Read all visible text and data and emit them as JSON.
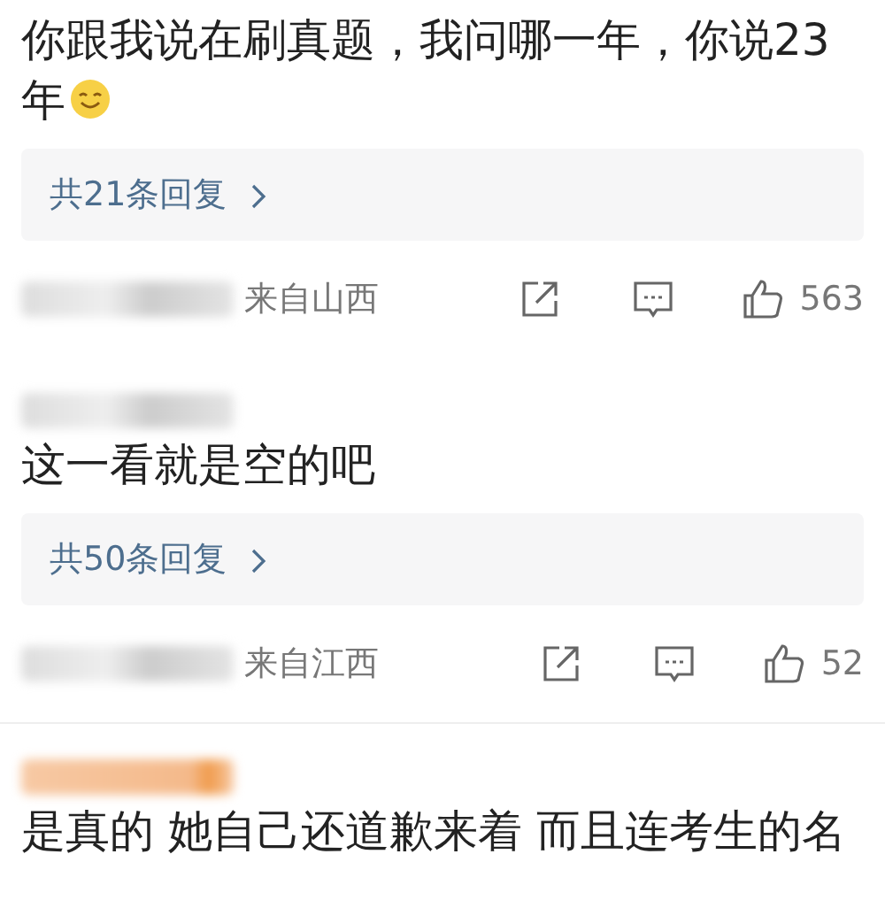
{
  "comments": [
    {
      "text": "你跟我说在刷真题，我问哪一年，你说23年",
      "emoji": true,
      "replies": "共21条回复",
      "location": "来自山西",
      "likes": "563"
    },
    {
      "vip": false,
      "text": "这一看就是空的吧",
      "replies": "共50条回复",
      "location": "来自江西",
      "likes": "52"
    },
    {
      "vip": true,
      "text": "是真的 她自己还道歉来着 而且连考生的名"
    }
  ]
}
